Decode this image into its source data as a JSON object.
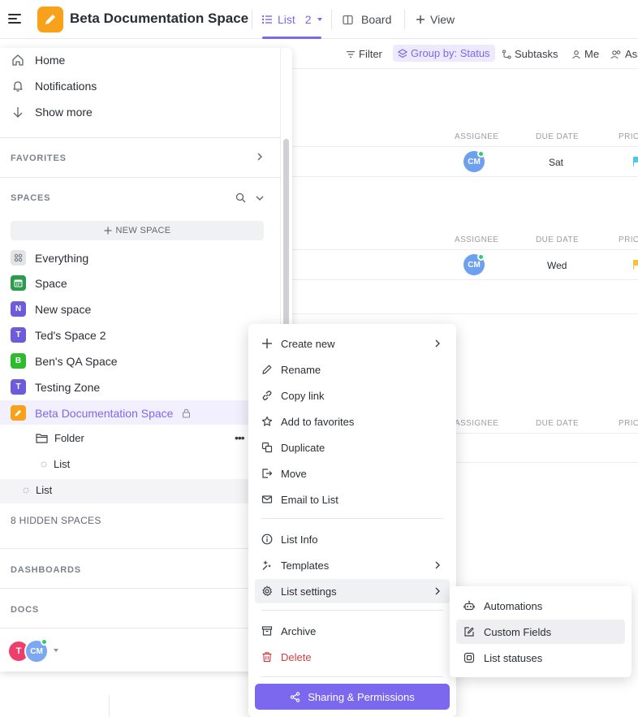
{
  "header": {
    "space_title": "Beta Documentation Space",
    "tabs": [
      {
        "label": "List",
        "count": "2",
        "icon": "list-icon"
      },
      {
        "label": "Board",
        "icon": "board-icon"
      },
      {
        "label": "View",
        "icon": "plus-icon"
      }
    ]
  },
  "toolbar": {
    "filter": "Filter",
    "group_by": "Group by: Status",
    "subtasks": "Subtasks",
    "me": "Me",
    "assignees": "Ass"
  },
  "table": {
    "col_assignee": "ASSIGNEE",
    "col_due": "DUE DATE",
    "col_priority": "PRIO",
    "rows": [
      {
        "assignee": "CM",
        "due": "Sat",
        "flag_color": "#4dc9e6"
      },
      {
        "assignee": "CM",
        "due": "Wed",
        "flag_color": "#f7c23a"
      }
    ]
  },
  "sidebar": {
    "nav": [
      {
        "label": "Home",
        "icon": "home-icon"
      },
      {
        "label": "Notifications",
        "icon": "bell-icon"
      },
      {
        "label": "Show more",
        "icon": "arrow-down-icon"
      }
    ],
    "favorites_label": "FAVORITES",
    "spaces_label": "SPACES",
    "new_space_label": "NEW SPACE",
    "spaces": [
      {
        "label": "Everything",
        "letter": "",
        "color": "#e3e4e8"
      },
      {
        "label": "Space",
        "letter": "",
        "color": "#2c9b4e"
      },
      {
        "label": "New space",
        "letter": "N",
        "color": "#6d5cd9"
      },
      {
        "label": "Ted's Space 2",
        "letter": "T",
        "color": "#6d5cd9"
      },
      {
        "label": "Ben's QA Space",
        "letter": "B",
        "color": "#2ebb2e"
      },
      {
        "label": "Testing Zone",
        "letter": "T",
        "color": "#6d5cd9"
      },
      {
        "label": "Beta Documentation Space",
        "letter": "",
        "color": "#f8a21c"
      }
    ],
    "folder_label": "Folder",
    "folder_list_label": "List",
    "list_label": "List",
    "hidden_spaces": "8 HIDDEN SPACES",
    "dashboards_label": "DASHBOARDS",
    "docs_label": "DOCS",
    "user_t": "T",
    "user_cm": "CM"
  },
  "menu": {
    "items": [
      {
        "label": "Create new",
        "icon": "plus-icon"
      },
      {
        "label": "Rename",
        "icon": "pencil-icon"
      },
      {
        "label": "Copy link",
        "icon": "link-icon"
      },
      {
        "label": "Add to favorites",
        "icon": "star-icon"
      },
      {
        "label": "Duplicate",
        "icon": "duplicate-icon"
      },
      {
        "label": "Move",
        "icon": "move-icon"
      },
      {
        "label": "Email to List",
        "icon": "mail-icon"
      },
      {
        "label": "List Info",
        "icon": "info-icon"
      },
      {
        "label": "Templates",
        "icon": "templates-icon"
      },
      {
        "label": "List settings",
        "icon": "gear-icon"
      },
      {
        "label": "Archive",
        "icon": "archive-icon"
      },
      {
        "label": "Delete",
        "icon": "trash-icon"
      }
    ],
    "share_label": "Sharing & Permissions"
  },
  "submenu": {
    "items": [
      {
        "label": "Automations",
        "icon": "robot-icon"
      },
      {
        "label": "Custom Fields",
        "icon": "edit-square-icon"
      },
      {
        "label": "List statuses",
        "icon": "status-square-icon"
      }
    ]
  },
  "colors": {
    "accent": "#7b68ee",
    "danger": "#d33d44",
    "space_orange": "#f8a21c"
  }
}
